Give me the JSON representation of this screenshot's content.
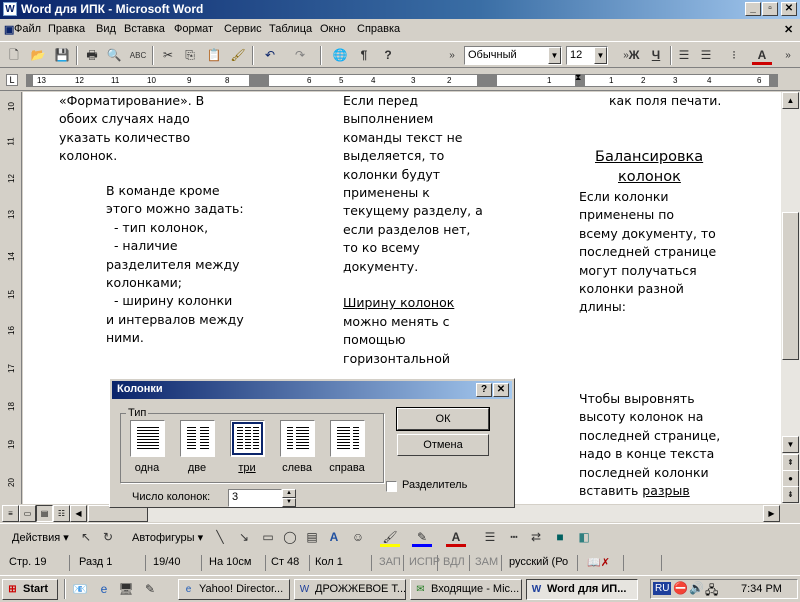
{
  "title": "Word для  ИПК - Microsoft Word",
  "menu": [
    "Файл",
    "Правка",
    "Вид",
    "Вставка",
    "Формат",
    "Сервис",
    "Таблица",
    "Окно",
    "Справка"
  ],
  "style_box": "Обычный",
  "font_size": "12",
  "ruler_numbers": [
    "13",
    "12",
    "11",
    "10",
    "9",
    "8",
    "6",
    "5",
    "4",
    "3",
    "2",
    "1",
    "1",
    "2",
    "3",
    "4",
    "6"
  ],
  "vruler_numbers": [
    "10",
    "11",
    "12",
    "13",
    "14",
    "15",
    "16",
    "17",
    "18",
    "19",
    "20"
  ],
  "doc": {
    "col1a": [
      "«Форматирование». В",
      "обоих случаях надо",
      "указать количество",
      "колонок."
    ],
    "col1b": [
      "В команде кроме",
      "этого можно задать:",
      "  - тип колонок,",
      "  - наличие",
      "разделителя между",
      "колонками;",
      "  - ширину колонки",
      "и интервалов между",
      "ними."
    ],
    "col2": [
      "Если перед",
      "выполнением",
      "команды текст не",
      "выделяется, то",
      "колонки будут",
      "применены к",
      "текущему разделу, а",
      "если разделов нет,",
      "то ко всему",
      "документу."
    ],
    "col2_heading": "Ширину колонок",
    "col2_after": [
      "можно менять с",
      "помощью",
      "горизонтальной"
    ],
    "col3_top": "как поля печати.",
    "col3_heading_1": "Балансировка",
    "col3_heading_2": "колонок",
    "col3a": [
      "Если колонки",
      "применены по",
      "всему документу, то",
      "последней странице",
      "могут получаться",
      "колонки разной",
      "длины:"
    ],
    "col3b": [
      "Чтобы выровнять",
      "высоту колонок на",
      "последней странице,",
      "надо в конце текста",
      "последней колонки",
      "вставить "
    ],
    "col3b_link": "разрыв"
  },
  "dialog": {
    "title": "Колонки",
    "group": "Тип",
    "presets": [
      "одна",
      "две",
      "три",
      "слева",
      "справа"
    ],
    "ok": "ОК",
    "cancel": "Отмена",
    "separator": "Разделитель",
    "count_label": "Число колонок:",
    "count_value": "3"
  },
  "drawing": {
    "actions": "Действия",
    "autoshapes": "Автофигуры"
  },
  "status": {
    "page": "Стр.  19",
    "section": "Разд  1",
    "pages": "19/40",
    "at": "На  10см",
    "line": "Ст  48",
    "col": "Кол  1",
    "rec": "ЗАП",
    "trk": "ИСПР",
    "ext": "ВДЛ",
    "ovr": "ЗАМ",
    "lang": "русский (Ро"
  },
  "taskbar": {
    "start": "Start",
    "tasks": [
      "Yahoo! Director...",
      "ДРОЖЖЕВОЕ Т...",
      "Входящие - Mic...",
      "Word для  ИП..."
    ],
    "lang": "RU",
    "clock": "7:34 PM"
  },
  "colors": {
    "title_start": "#0a246a",
    "title_end": "#a6caf0",
    "chrome": "#d4d0c8"
  }
}
